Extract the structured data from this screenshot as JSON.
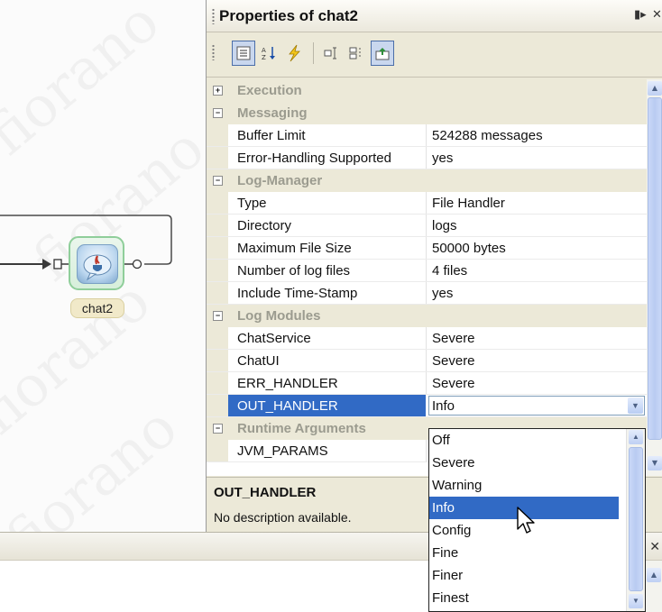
{
  "panel": {
    "title": "Properties of chat2",
    "toolbar_icons": [
      "categorized-icon",
      "alphabetical-sort-icon",
      "lightning-icon",
      "expand-icon",
      "collapse-icon",
      "export-icon"
    ]
  },
  "canvas": {
    "node_label": "chat2",
    "watermark_text": "fiorano"
  },
  "categories": {
    "execution": "Execution",
    "messaging": "Messaging",
    "log_manager": "Log-Manager",
    "log_modules": "Log Modules",
    "runtime_arguments": "Runtime Arguments"
  },
  "properties": {
    "buffer_limit": {
      "name": "Buffer Limit",
      "value": "524288 messages"
    },
    "error_handling": {
      "name": "Error-Handling Supported",
      "value": "yes"
    },
    "type": {
      "name": "Type",
      "value": "File Handler"
    },
    "directory": {
      "name": "Directory",
      "value": "logs"
    },
    "max_file_size": {
      "name": "Maximum File Size",
      "value": "50000 bytes"
    },
    "num_log_files": {
      "name": "Number of log files",
      "value": "4 files"
    },
    "include_timestamp": {
      "name": "Include Time-Stamp",
      "value": "yes"
    },
    "chat_service": {
      "name": "ChatService",
      "value": "Severe"
    },
    "chat_ui": {
      "name": "ChatUI",
      "value": "Severe"
    },
    "err_handler": {
      "name": "ERR_HANDLER",
      "value": "Severe"
    },
    "out_handler": {
      "name": "OUT_HANDLER",
      "value": "Info"
    },
    "jvm_params": {
      "name": "JVM_PARAMS",
      "value": ""
    }
  },
  "description": {
    "title": "OUT_HANDLER",
    "text": "No description available."
  },
  "dropdown": {
    "options": [
      "Off",
      "Severe",
      "Warning",
      "Info",
      "Config",
      "Fine",
      "Finer",
      "Finest"
    ],
    "selected": "Info"
  },
  "colors": {
    "selection": "#316ac5",
    "panel_bg": "#ece9d8",
    "node_border": "#8fce9a"
  }
}
